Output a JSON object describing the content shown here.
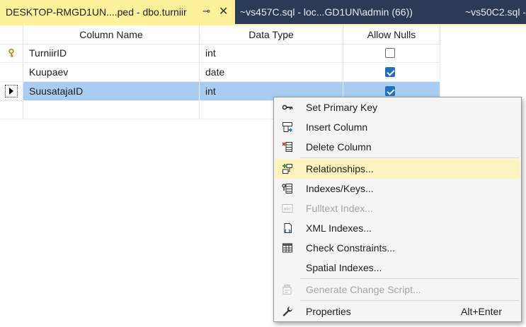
{
  "tabs": {
    "active": {
      "title": "DESKTOP-RMGD1UN....ped - dbo.turniir",
      "pin": "⊸",
      "close": "✕"
    },
    "inactive": [
      {
        "title": "~vs457C.sql - loc...GD1UN\\admin (66))"
      },
      {
        "title": "~vs50C2.sql -"
      }
    ]
  },
  "grid": {
    "headers": {
      "column_name": "Column Name",
      "data_type": "Data Type",
      "allow_nulls": "Allow Nulls"
    },
    "rows": [
      {
        "name": "TurniirID",
        "type": "int",
        "allow_nulls": false,
        "primary_key": true,
        "selected": false
      },
      {
        "name": "Kuupaev",
        "type": "date",
        "allow_nulls": true,
        "primary_key": false,
        "selected": false
      },
      {
        "name": "SuusatajaID",
        "type": "int",
        "allow_nulls": true,
        "primary_key": false,
        "selected": true
      }
    ]
  },
  "context_menu": {
    "items": [
      {
        "label": "Set Primary Key",
        "icon": "key-icon",
        "enabled": true
      },
      {
        "label": "Insert Column",
        "icon": "insert-column-icon",
        "enabled": true
      },
      {
        "label": "Delete Column",
        "icon": "delete-column-icon",
        "enabled": true
      },
      {
        "label": "Relationships...",
        "icon": "relationships-icon",
        "enabled": true,
        "highlighted": true
      },
      {
        "label": "Indexes/Keys...",
        "icon": "indexes-keys-icon",
        "enabled": true
      },
      {
        "label": "Fulltext Index...",
        "icon": "fulltext-index-icon",
        "enabled": false
      },
      {
        "label": "XML Indexes...",
        "icon": "xml-indexes-icon",
        "enabled": true
      },
      {
        "label": "Check Constraints...",
        "icon": "check-constraints-icon",
        "enabled": true
      },
      {
        "label": "Spatial Indexes...",
        "icon": "spatial-indexes-icon",
        "enabled": true
      },
      {
        "label": "Generate Change Script...",
        "icon": "generate-script-icon",
        "enabled": false
      },
      {
        "label": "Properties",
        "icon": "wrench-icon",
        "enabled": true,
        "shortcut": "Alt+Enter"
      }
    ]
  },
  "colors": {
    "tab_active": "#fff29d",
    "tab_strip": "#2b3a55",
    "selection": "#a8cdf0",
    "menu_highlight": "#fdf4bf",
    "checkbox_on": "#1f6fc5"
  }
}
